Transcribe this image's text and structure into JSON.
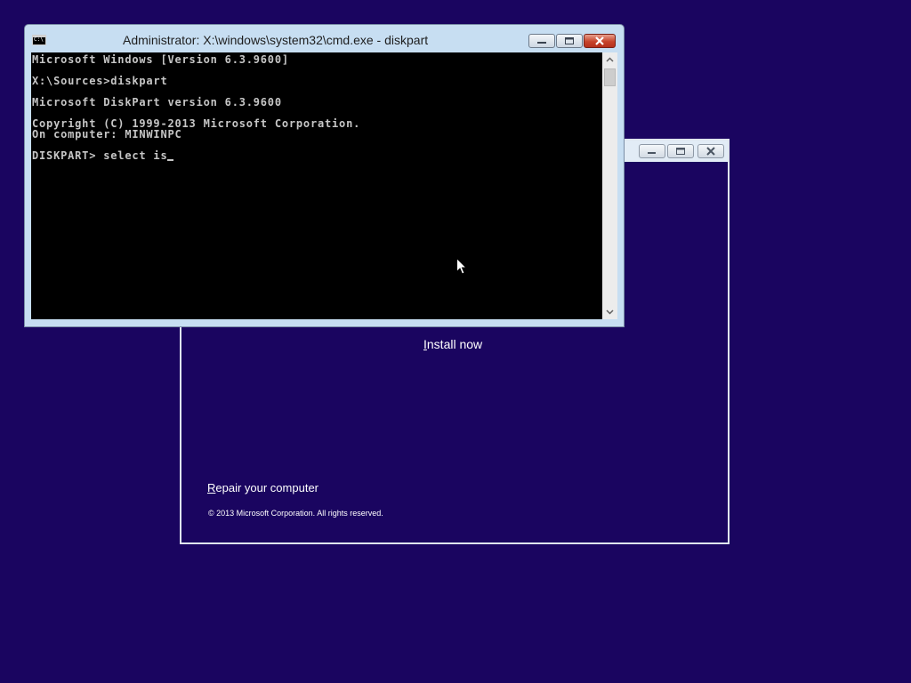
{
  "cmd_window": {
    "title": "Administrator: X:\\windows\\system32\\cmd.exe - diskpart",
    "icon_text": "C:\\",
    "console_lines": [
      "Microsoft Windows [Version 6.3.9600]",
      "",
      "X:\\Sources>diskpart",
      "",
      "Microsoft DiskPart version 6.3.9600",
      "",
      "Copyright (C) 1999-2013 Microsoft Corporation.",
      "On computer: MINWINPC",
      "",
      "DISKPART> select is"
    ],
    "controls": [
      "minimize-icon",
      "maximize-icon",
      "close-icon"
    ]
  },
  "setup_window": {
    "install_now_accel": "I",
    "install_now_rest": "nstall now",
    "repair_accel": "R",
    "repair_rest": "epair your computer",
    "copyright": "© 2013 Microsoft Corporation. All rights reserved.",
    "controls": [
      "minimize-icon",
      "maximize-icon",
      "close-icon"
    ]
  },
  "colors": {
    "desktop_background": "#1a0560",
    "console_background": "#000000",
    "console_text": "#c6c6c6",
    "close_button": "#c7432b"
  }
}
